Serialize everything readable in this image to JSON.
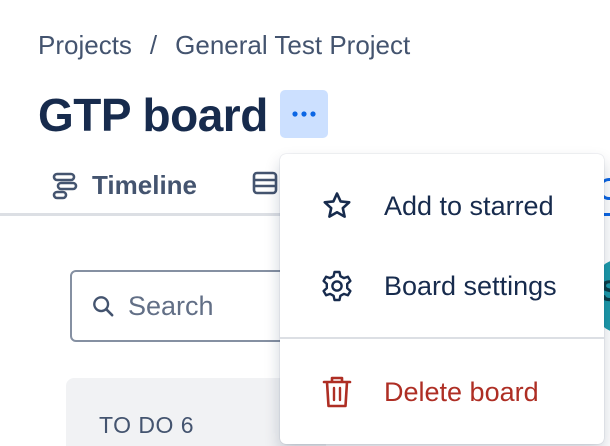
{
  "breadcrumb": {
    "items": [
      "Projects",
      "General Test Project"
    ],
    "separator": "/"
  },
  "board": {
    "title": "GTP board",
    "more_icon": "ellipsis-icon"
  },
  "tabs": [
    {
      "label": "Timeline",
      "icon": "timeline-icon"
    },
    {
      "label": "",
      "icon": "backlog-icon"
    }
  ],
  "search": {
    "placeholder": "Search",
    "value": "",
    "icon": "search-icon"
  },
  "avatar": {
    "initial": "S"
  },
  "columns": [
    {
      "title": "TO DO 6"
    }
  ],
  "menu": {
    "items": [
      {
        "label": "Add to starred",
        "icon": "star-icon"
      },
      {
        "label": "Board settings",
        "icon": "gear-icon"
      },
      {
        "label": "Delete board",
        "icon": "trash-icon"
      }
    ]
  },
  "colors": {
    "text": "#172b4d",
    "subtle": "#44546f",
    "accent": "#0c66e4",
    "danger": "#ae2e24",
    "button_selected": "#cce0ff"
  }
}
